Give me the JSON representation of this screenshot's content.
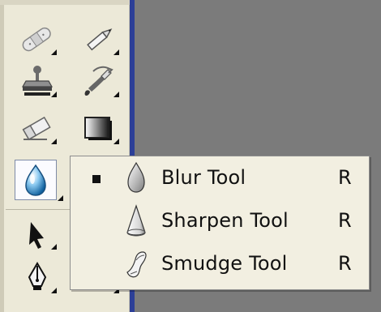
{
  "colors": {
    "canvas_background": "#7b7b7b",
    "toolbox_background": "#ece9d8",
    "toolbox_border_accent": "#2c3f97",
    "menu_background": "#f2efe1"
  },
  "toolbox": {
    "tools": [
      {
        "name": "healing-brush-tool",
        "icon": "bandage-icon"
      },
      {
        "name": "pencil-tool",
        "icon": "pencil-icon"
      },
      {
        "name": "clone-stamp-tool",
        "icon": "stamp-icon"
      },
      {
        "name": "history-brush-tool",
        "icon": "history-brush-icon"
      },
      {
        "name": "eraser-tool",
        "icon": "eraser-icon"
      },
      {
        "name": "gradient-tool",
        "icon": "gradient-icon"
      },
      {
        "name": "blur-tool",
        "icon": "blur-drop-icon",
        "selected": true
      },
      {
        "name": "path-selection-tool",
        "icon": "arrow-icon"
      },
      {
        "name": "pen-tool",
        "icon": "pen-icon"
      }
    ]
  },
  "flyout": {
    "items": [
      {
        "label": "Blur Tool",
        "shortcut": "R",
        "icon": "blur-drop-icon",
        "selected": true
      },
      {
        "label": "Sharpen Tool",
        "shortcut": "R",
        "icon": "sharpen-cone-icon",
        "selected": false
      },
      {
        "label": "Smudge Tool",
        "shortcut": "R",
        "icon": "smudge-finger-icon",
        "selected": false
      }
    ]
  }
}
